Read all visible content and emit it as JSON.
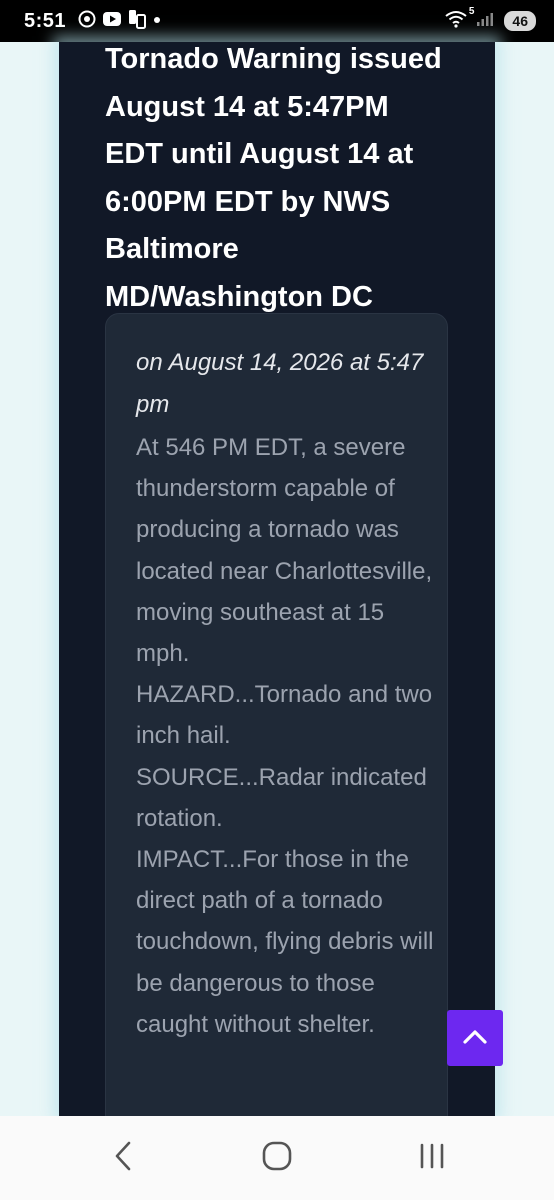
{
  "status_bar": {
    "time": "5:51",
    "network": "5",
    "battery": "46"
  },
  "alert": {
    "title": "Tornado Warning issued August 14 at 5:47PM EDT until August 14 at 6:00PM EDT by NWS Baltimore MD/Washington DC",
    "date": "on August 14, 2026 at 5:47 pm",
    "body_lines": [
      "At 546 PM EDT, a severe thunderstorm capable of producing a tornado was located near Charlottesville, moving southeast at 15 mph.",
      "HAZARD...Tornado and two inch hail.",
      "SOURCE...Radar indicated rotation.",
      "IMPACT...For those in the direct path of a tornado touchdown, flying debris will be dangerous to those caught without shelter."
    ]
  },
  "colors": {
    "panel_bg": "#111827",
    "card_bg": "#1f2937",
    "accent": "#6d28f0"
  }
}
